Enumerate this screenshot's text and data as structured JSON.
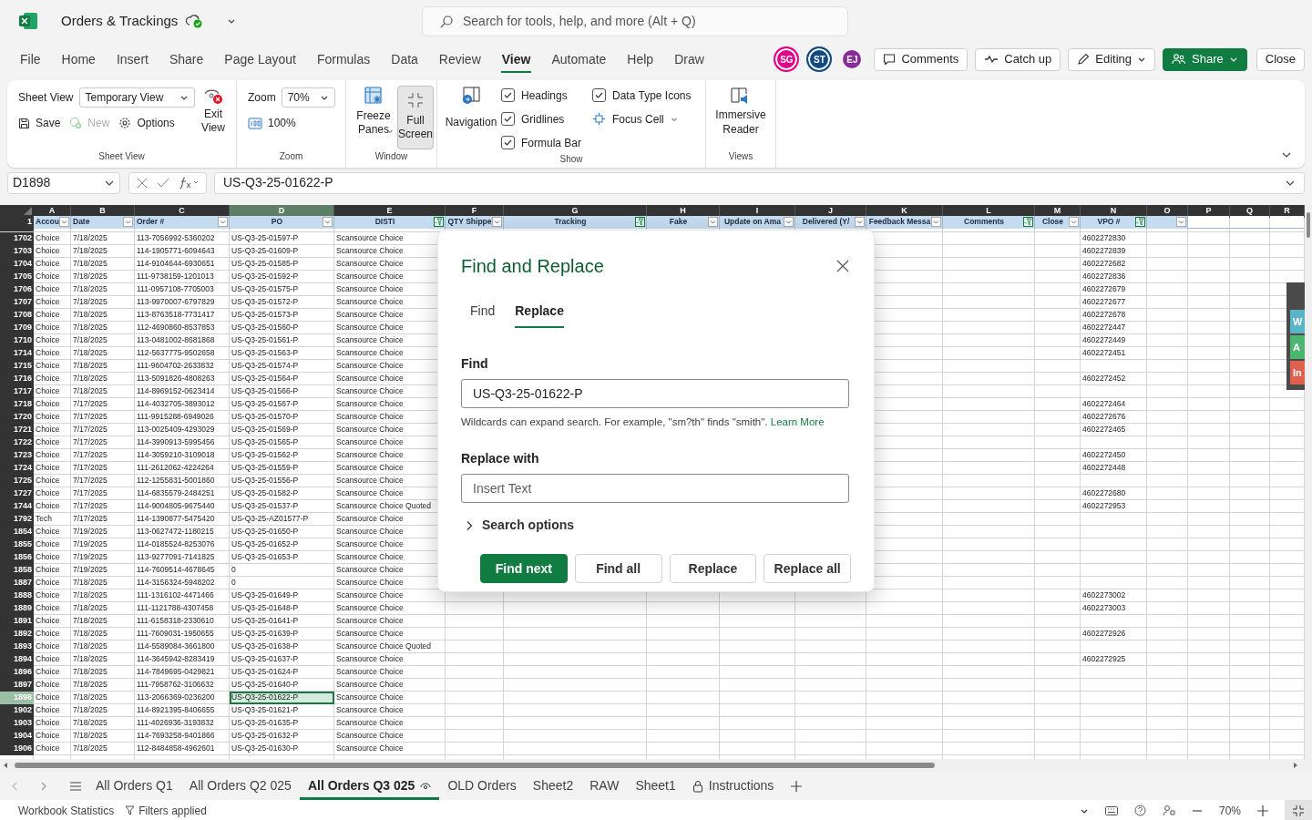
{
  "app": {
    "title": "Orders & Trackings",
    "search_placeholder": "Search for tools, help, and more (Alt + Q)"
  },
  "menu": [
    {
      "label": "File",
      "selected": false
    },
    {
      "label": "Home",
      "selected": false
    },
    {
      "label": "Insert",
      "selected": false
    },
    {
      "label": "Share",
      "selected": false
    },
    {
      "label": "Page Layout",
      "selected": false
    },
    {
      "label": "Formulas",
      "selected": false
    },
    {
      "label": "Data",
      "selected": false
    },
    {
      "label": "Review",
      "selected": false
    },
    {
      "label": "View",
      "selected": true
    },
    {
      "label": "Automate",
      "selected": false
    },
    {
      "label": "Help",
      "selected": false
    },
    {
      "label": "Draw",
      "selected": false
    }
  ],
  "avatars": [
    {
      "initials": "SG",
      "color": "#e3008c",
      "ringed": true
    },
    {
      "initials": "ST",
      "color": "#0f4a85",
      "ringed": true
    },
    {
      "initials": "EJ",
      "color": "#8a2b9c",
      "ringed": false
    }
  ],
  "actions": {
    "comments": "Comments",
    "catch_up": "Catch up",
    "editing": "Editing",
    "share": "Share",
    "close": "Close"
  },
  "ribbon": {
    "sheet_view": {
      "group": "Sheet View",
      "field_label": "Sheet View",
      "view": "Temporary View",
      "save": "Save",
      "new": "New",
      "new_disabled": true,
      "options": "Options",
      "exit": "Exit View"
    },
    "zoom": {
      "group": "Zoom",
      "label": "Zoom",
      "value": "70%",
      "reset": "100%"
    },
    "window": {
      "group": "Window",
      "freeze": "Freeze Panes",
      "full_screen": "Full Screen",
      "full_screen_pressed": true
    },
    "show": {
      "group": "Show",
      "navigation": "Navigation",
      "options": [
        {
          "kind": "checkbox",
          "label": "Headings",
          "checked": true
        },
        {
          "kind": "checkbox",
          "label": "Gridlines",
          "checked": true
        },
        {
          "kind": "checkbox",
          "label": "Formula Bar",
          "checked": true
        },
        {
          "kind": "checkbox",
          "label": "Data Type Icons",
          "checked": true
        },
        {
          "kind": "dropdown",
          "label": "Focus Cell"
        }
      ]
    },
    "views": {
      "group": "Views",
      "immersive": "Immersive Reader"
    }
  },
  "formula_bar": {
    "name_box": "D1898",
    "formula": "US-Q3-25-01622-P"
  },
  "sheet": {
    "header_row_number": "1",
    "columns": [
      {
        "letter": "A",
        "header": "Accou",
        "dropdown": true,
        "filtered": false,
        "selected": false
      },
      {
        "letter": "B",
        "header": "Date",
        "dropdown": true,
        "filtered": false,
        "selected": false
      },
      {
        "letter": "C",
        "header": "Order #",
        "dropdown": true,
        "filtered": false,
        "selected": false
      },
      {
        "letter": "D",
        "header": "PO",
        "dropdown": true,
        "filtered": false,
        "selected": true
      },
      {
        "letter": "E",
        "header": "DISTI",
        "dropdown": true,
        "filtered": true,
        "selected": false
      },
      {
        "letter": "F",
        "header": "QTY Shippe",
        "dropdown": true,
        "filtered": false,
        "selected": false
      },
      {
        "letter": "G",
        "header": "Tracking",
        "dropdown": true,
        "filtered": true,
        "selected": false
      },
      {
        "letter": "H",
        "header": "Fake",
        "dropdown": true,
        "filtered": false,
        "selected": false
      },
      {
        "letter": "I",
        "header": "Update on Ama",
        "dropdown": true,
        "filtered": false,
        "selected": false
      },
      {
        "letter": "J",
        "header": "Delivered (Y/",
        "dropdown": true,
        "filtered": false,
        "selected": false
      },
      {
        "letter": "K",
        "header": "Feedback Messa",
        "dropdown": true,
        "filtered": false,
        "selected": false
      },
      {
        "letter": "L",
        "header": "Comments",
        "dropdown": true,
        "filtered": true,
        "selected": false
      },
      {
        "letter": "M",
        "header": "Close",
        "dropdown": true,
        "filtered": false,
        "selected": false
      },
      {
        "letter": "N",
        "header": "VPO #",
        "dropdown": true,
        "filtered": true,
        "selected": false
      },
      {
        "letter": "O",
        "dropdown": true,
        "filtered": false,
        "selected": false
      },
      {
        "letter": "P",
        "dropdown": false,
        "selected": false
      },
      {
        "letter": "Q",
        "dropdown": false,
        "selected": false
      },
      {
        "letter": "R",
        "dropdown": false,
        "selected": false
      }
    ],
    "rows": [
      {
        "n": "1702",
        "account": "Choice",
        "date": "7/18/2025",
        "order": "113-7056992-5360202",
        "po": "US-Q3-25-01597-P",
        "disti": "Scansource Choice",
        "vpo": "4602272830",
        "selected": false
      },
      {
        "n": "1703",
        "account": "Choice",
        "date": "7/18/2025",
        "order": "114-1905771-6094643",
        "po": "US-Q3-25-01609-P",
        "disti": "Scansource Choice",
        "vpo": "4602272839",
        "selected": false
      },
      {
        "n": "1704",
        "account": "Choice",
        "date": "7/18/2025",
        "order": "114-9104644-6930651",
        "po": "US-Q3-25-01585-P",
        "disti": "Scansource Choice",
        "vpo": "4602272682",
        "selected": false
      },
      {
        "n": "1705",
        "account": "Choice",
        "date": "7/18/2025",
        "order": "111-9738159-1201013",
        "po": "US-Q3-25-01592-P",
        "disti": "Scansource Choice",
        "vpo": "4602272836",
        "selected": false
      },
      {
        "n": "1706",
        "account": "Choice",
        "date": "7/18/2025",
        "order": "111-0957108-7705003",
        "po": "US-Q3-25-01575-P",
        "disti": "Scansource Choice",
        "vpo": "4602272679",
        "selected": false
      },
      {
        "n": "1707",
        "account": "Choice",
        "date": "7/18/2025",
        "order": "113-9970007-6797829",
        "po": "US-Q3-25-01572-P",
        "disti": "Scansource Choice",
        "vpo": "4602272677",
        "selected": false
      },
      {
        "n": "1708",
        "account": "Choice",
        "date": "7/18/2025",
        "order": "113-8763518-7731417",
        "po": "US-Q3-25-01573-P",
        "disti": "Scansource Choice",
        "vpo": "4602272678",
        "selected": false
      },
      {
        "n": "1709",
        "account": "Choice",
        "date": "7/18/2025",
        "order": "112-4690860-8537853",
        "po": "US-Q3-25-01560-P",
        "disti": "Scansource Choice",
        "vpo": "4602272447",
        "selected": false
      },
      {
        "n": "1710",
        "account": "Choice",
        "date": "7/18/2025",
        "order": "113-0481002-8681868",
        "po": "US-Q3-25-01561-P",
        "disti": "Scansource Choice",
        "vpo": "4602272449",
        "selected": false
      },
      {
        "n": "1714",
        "account": "Choice",
        "date": "7/18/2025",
        "order": "112-5637775-9502658",
        "po": "US-Q3-25-01563-P",
        "disti": "Scansource Choice",
        "vpo": "4602272451",
        "selected": false
      },
      {
        "n": "1715",
        "account": "Choice",
        "date": "7/18/2025",
        "order": "111-9604702-2633832",
        "po": "US-Q3-25-01574-P",
        "disti": "Scansource Choice",
        "selected": false
      },
      {
        "n": "1716",
        "account": "Choice",
        "date": "7/18/2025",
        "order": "113-5091826-4808263",
        "po": "US-Q3-25-01564-P",
        "disti": "Scansource Choice",
        "vpo": "4602272452",
        "selected": false
      },
      {
        "n": "1717",
        "account": "Choice",
        "date": "7/18/2025",
        "order": "114-8969152-0623414",
        "po": "US-Q3-25-01566-P",
        "disti": "Scansource Choice",
        "selected": false
      },
      {
        "n": "1718",
        "account": "Choice",
        "date": "7/17/2025",
        "order": "114-4032705-3893012",
        "po": "US-Q3-25-01567-P",
        "disti": "Scansource Choice",
        "vpo": "4602272464",
        "selected": false
      },
      {
        "n": "1720",
        "account": "Choice",
        "date": "7/17/2025",
        "order": "111-9915288-6949026",
        "po": "US-Q3-25-01570-P",
        "disti": "Scansource Choice",
        "vpo": "4602272676",
        "selected": false
      },
      {
        "n": "1721",
        "account": "Choice",
        "date": "7/17/2025",
        "order": "113-0025409-4293029",
        "po": "US-Q3-25-01569-P",
        "disti": "Scansource Choice",
        "vpo": "4602272465",
        "selected": false
      },
      {
        "n": "1722",
        "account": "Choice",
        "date": "7/17/2025",
        "order": "114-3990913-5995456",
        "po": "US-Q3-25-01565-P",
        "disti": "Scansource Choice",
        "selected": false
      },
      {
        "n": "1723",
        "account": "Choice",
        "date": "7/17/2025",
        "order": "114-3059210-3109018",
        "po": "US-Q3-25-01562-P",
        "disti": "Scansource Choice",
        "vpo": "4602272450",
        "selected": false
      },
      {
        "n": "1724",
        "account": "Choice",
        "date": "7/17/2025",
        "order": "111-2612062-4224264",
        "po": "US-Q3-25-01559-P",
        "disti": "Scansource Choice",
        "vpo": "4602272448",
        "selected": false
      },
      {
        "n": "1725",
        "account": "Choice",
        "date": "7/17/2025",
        "order": "112-1255831-5001860",
        "po": "US-Q3-25-01556-P",
        "disti": "Scansource Choice",
        "selected": false
      },
      {
        "n": "1727",
        "account": "Choice",
        "date": "7/17/2025",
        "order": "114-6835579-2484251",
        "po": "US-Q3-25-01582-P",
        "disti": "Scansource Choice",
        "vpo": "4602272680",
        "selected": false
      },
      {
        "n": "1744",
        "account": "Choice",
        "date": "7/17/2025",
        "order": "114-9004805-9675440",
        "po": "US-Q3-25-01537-P",
        "disti": "Scansource Choice Quoted",
        "vpo": "4602272953",
        "selected": false
      },
      {
        "n": "1792",
        "account": "Tech",
        "date": "7/17/2025",
        "order": "114-1390877-5475420",
        "po": "US-Q3-25-AZ01577-P",
        "disti": "Scansource Choice",
        "selected": false
      },
      {
        "n": "1854",
        "account": "Choice",
        "date": "7/19/2025",
        "order": "113-0627472-1180215",
        "po": "US-Q3-25-01650-P",
        "disti": "Scansource Choice",
        "selected": false
      },
      {
        "n": "1855",
        "account": "Choice",
        "date": "7/19/2025",
        "order": "114-0185524-8253076",
        "po": "US-Q3-25-01652-P",
        "disti": "Scansource Choice",
        "selected": false
      },
      {
        "n": "1856",
        "account": "Choice",
        "date": "7/19/2025",
        "order": "113-9277091-7141825",
        "po": "US-Q3-25-01653-P",
        "disti": "Scansource Choice",
        "selected": false
      },
      {
        "n": "1858",
        "account": "Choice",
        "date": "7/19/2025",
        "order": "114-7609514-4678645",
        "po": "0",
        "disti": "Scansource Choice",
        "selected": false
      },
      {
        "n": "1887",
        "account": "Choice",
        "date": "7/18/2025",
        "order": "114-3156324-5948202",
        "po": "0",
        "disti": "Scansource Choice",
        "selected": false
      },
      {
        "n": "1888",
        "account": "Choice",
        "date": "7/18/2025",
        "order": "111-1316102-4471466",
        "po": "US-Q3-25-01649-P",
        "disti": "Scansource Choice",
        "vpo": "4602273002",
        "selected": false
      },
      {
        "n": "1889",
        "account": "Choice",
        "date": "7/18/2025",
        "order": "111-1121788-4307458",
        "po": "US-Q3-25-01648-P",
        "disti": "Scansource Choice",
        "vpo": "4602273003",
        "selected": false
      },
      {
        "n": "1891",
        "account": "Choice",
        "date": "7/18/2025",
        "order": "111-6158318-2330610",
        "po": "US-Q3-25-01641-P",
        "disti": "Scansource Choice",
        "selected": false
      },
      {
        "n": "1892",
        "account": "Choice",
        "date": "7/18/2025",
        "order": "111-7609031-1950655",
        "po": "US-Q3-25-01639-P",
        "disti": "Scansource Choice",
        "vpo": "4602272926",
        "selected": false
      },
      {
        "n": "1893",
        "account": "Choice",
        "date": "7/18/2025",
        "order": "114-5589084-3661800",
        "po": "US-Q3-25-01638-P",
        "disti": "Scansource Choice Quoted",
        "selected": false
      },
      {
        "n": "1894",
        "account": "Choice",
        "date": "7/18/2025",
        "order": "114-3645942-8283419",
        "po": "US-Q3-25-01637-P",
        "disti": "Scansource Choice",
        "vpo": "4602272925",
        "selected": false
      },
      {
        "n": "1896",
        "account": "Choice",
        "date": "7/18/2025",
        "order": "114-7849695-0429821",
        "po": "US-Q3-25-01624-P",
        "disti": "Scansource Choice",
        "selected": false
      },
      {
        "n": "1897",
        "account": "Choice",
        "date": "7/18/2025",
        "order": "111-7958762-3106632",
        "po": "US-Q3-25-01640-P",
        "disti": "Scansource Choice",
        "selected": false
      },
      {
        "n": "1898",
        "account": "Choice",
        "date": "7/18/2025",
        "order": "113-2066369-0236200",
        "po": "US-Q3-25-01622-P",
        "disti": "Scansource Choice",
        "selected": true
      },
      {
        "n": "1902",
        "account": "Choice",
        "date": "7/18/2025",
        "order": "114-8921395-8406655",
        "po": "US-Q3-25-01621-P",
        "disti": "Scansource Choice",
        "selected": false
      },
      {
        "n": "1903",
        "account": "Choice",
        "date": "7/18/2025",
        "order": "111-4026936-3193832",
        "po": "US-Q3-25-01635-P",
        "disti": "Scansource Choice",
        "selected": false
      },
      {
        "n": "1904",
        "account": "Choice",
        "date": "7/18/2025",
        "order": "114-7693258-9401866",
        "po": "US-Q3-25-01632-P",
        "disti": "Scansource Choice",
        "selected": false
      },
      {
        "n": "1906",
        "account": "Choice",
        "date": "7/18/2025",
        "order": "112-8484858-4962601",
        "po": "US-Q3-25-01630-P",
        "disti": "Scansource Choice",
        "selected": false
      }
    ]
  },
  "side_panel": [
    {
      "label": "W",
      "color": "#5bb3c7"
    },
    {
      "label": "A",
      "color": "#4cb572"
    },
    {
      "label": "In",
      "color": "#e0604f"
    }
  ],
  "dialog": {
    "title": "Find and Replace",
    "tabs": [
      {
        "label": "Find",
        "selected": false
      },
      {
        "label": "Replace",
        "selected": true
      }
    ],
    "find_label": "Find",
    "find_value": "US-Q3-25-01622-P",
    "hint": "Wildcards can expand search. For example, \"sm?th\" finds \"smith\".",
    "hint_link": "Learn More",
    "replace_label": "Replace with",
    "replace_placeholder": "Insert Text",
    "search_options": "Search options",
    "search_options_expanded": false,
    "buttons": [
      {
        "label": "Find next",
        "primary": true
      },
      {
        "label": "Find all",
        "primary": false
      },
      {
        "label": "Replace",
        "primary": false
      },
      {
        "label": "Replace all",
        "primary": false
      }
    ]
  },
  "sheet_tabs": [
    {
      "label": "All Orders Q1",
      "selected": false,
      "viewed": false,
      "locked": false
    },
    {
      "label": "All Orders Q2 025",
      "selected": false,
      "viewed": false,
      "locked": false
    },
    {
      "label": "All Orders Q3 025",
      "selected": true,
      "viewed": true,
      "locked": false
    },
    {
      "label": "OLD Orders",
      "selected": false,
      "viewed": false,
      "locked": false
    },
    {
      "label": "Sheet2",
      "selected": false,
      "viewed": false,
      "locked": false
    },
    {
      "label": "RAW",
      "selected": false,
      "viewed": false,
      "locked": false
    },
    {
      "label": "Sheet1",
      "selected": false,
      "viewed": false,
      "locked": false
    },
    {
      "label": "Instructions",
      "selected": false,
      "viewed": false,
      "locked": true
    }
  ],
  "status_bar": {
    "statistics": "Workbook Statistics",
    "filters": "Filters applied",
    "zoom": "70%"
  }
}
